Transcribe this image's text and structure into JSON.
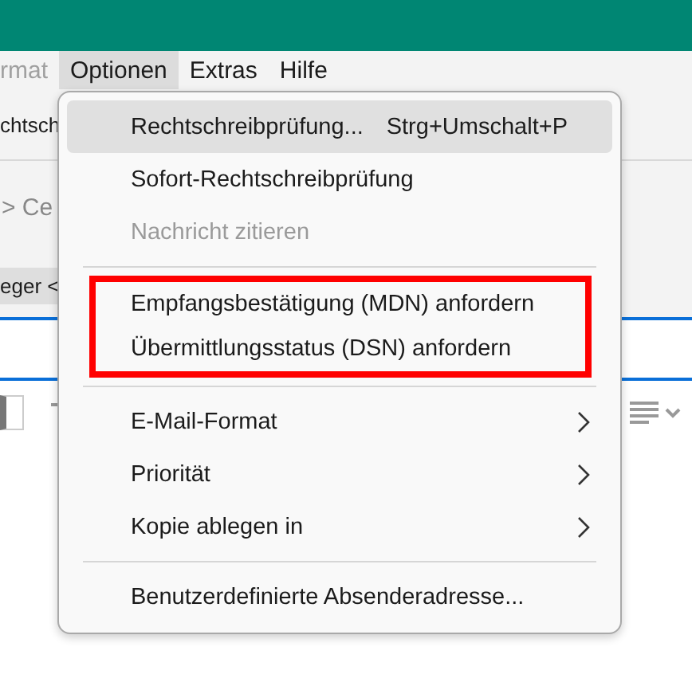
{
  "menubar": [
    {
      "label": "rmat",
      "selected": false,
      "disabled": true
    },
    {
      "label": "Optionen",
      "selected": true,
      "disabled": false
    },
    {
      "label": "Extras",
      "selected": false,
      "disabled": false
    },
    {
      "label": "Hilfe",
      "selected": false,
      "disabled": false
    }
  ],
  "backdrop": {
    "toolbar_button": "chtsch",
    "breadcrumb": "> Ce",
    "recipient_tag": "eger <"
  },
  "menu": {
    "groups": [
      {
        "outlined": false,
        "items": [
          {
            "label": "Rechtschreibprüfung...",
            "shortcut": "Strg+Umschalt+P",
            "submenu": false,
            "disabled": false,
            "selected": true
          },
          {
            "label": "Sofort-Rechtschreibprüfung",
            "submenu": false,
            "disabled": false,
            "selected": false
          },
          {
            "label": "Nachricht zitieren",
            "submenu": false,
            "disabled": true,
            "selected": false
          }
        ]
      },
      {
        "outlined": true,
        "items": [
          {
            "label": "Empfangsbestätigung (MDN) anfordern",
            "submenu": false,
            "disabled": false,
            "selected": false
          },
          {
            "label": "Übermittlungsstatus (DSN) anfordern",
            "submenu": false,
            "disabled": false,
            "selected": false
          }
        ]
      },
      {
        "outlined": false,
        "items": [
          {
            "label": "E-Mail-Format",
            "submenu": true,
            "disabled": false,
            "selected": false
          },
          {
            "label": "Priorität",
            "submenu": true,
            "disabled": false,
            "selected": false
          },
          {
            "label": "Kopie ablegen in",
            "submenu": true,
            "disabled": false,
            "selected": false
          }
        ]
      },
      {
        "outlined": false,
        "items": [
          {
            "label": "Benutzerdefinierte Absenderadresse...",
            "submenu": false,
            "disabled": false,
            "selected": false
          }
        ]
      }
    ]
  }
}
